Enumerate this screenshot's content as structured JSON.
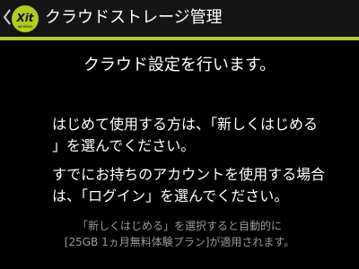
{
  "header": {
    "title": "クラウドストレージ管理",
    "logo_text": "Xit",
    "logo_subtext": "wireless",
    "accent_color": "#b1cc1c",
    "back_icon": "chevron-left-icon"
  },
  "content": {
    "lead": "クラウド設定を行います。",
    "paragraph_first_use": [
      "はじめて使用する方は、「新しくはじめる",
      "」を選んでください。"
    ],
    "paragraph_existing_account": [
      "すでにお持ちのアカウントを使用する場合",
      "は、「ログイン」を選んでください。"
    ],
    "note": [
      "「新しくはじめる」を選択すると自動的に",
      "[25GB 1ヵ月無料体験プラン]が適用されます。"
    ]
  }
}
